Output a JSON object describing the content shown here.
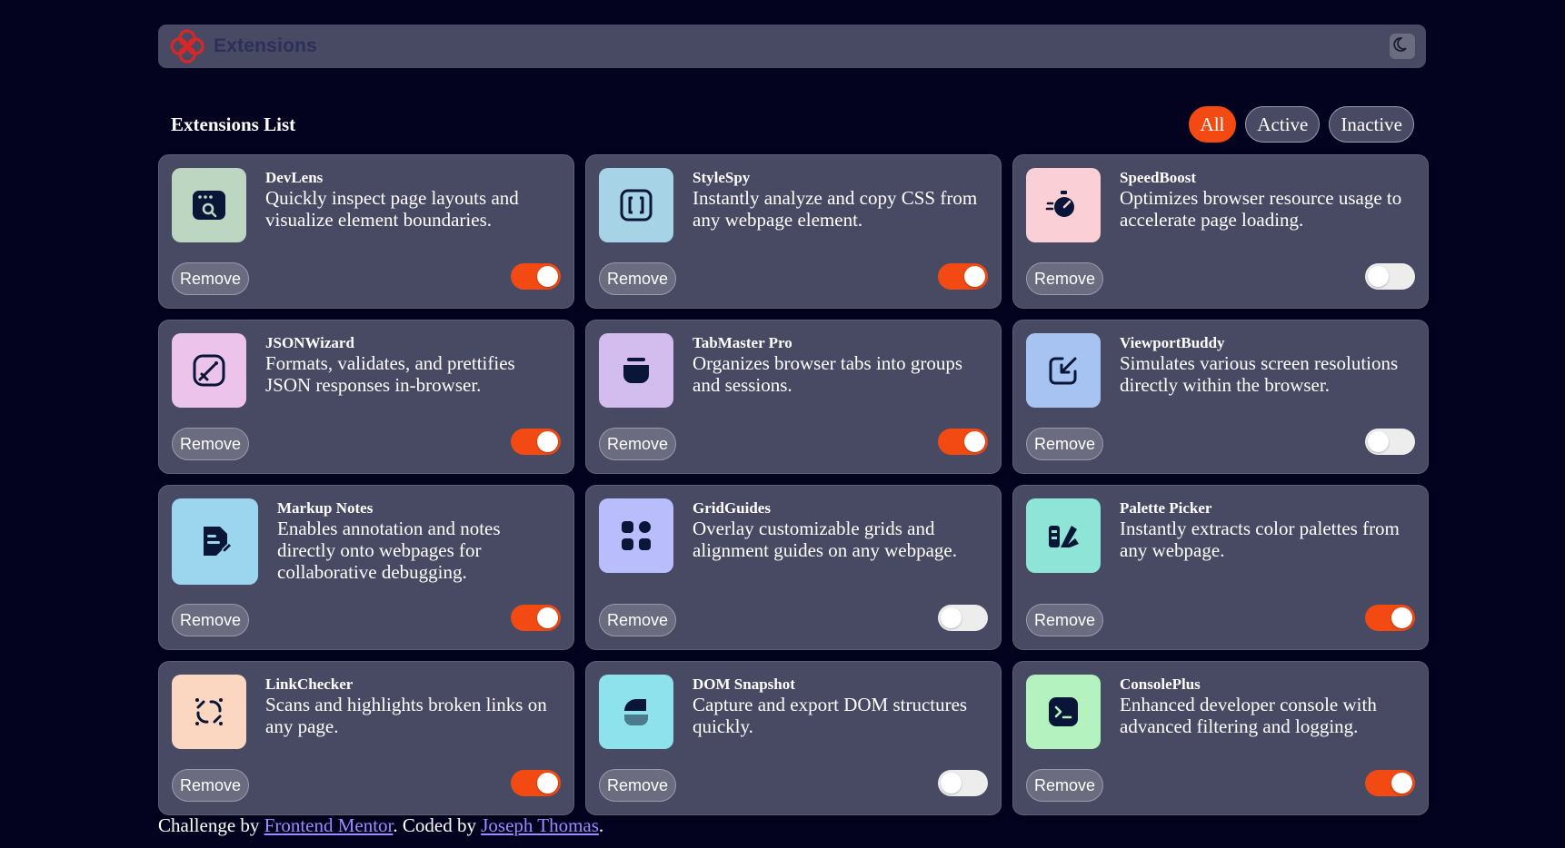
{
  "header": {
    "logo_text": "Extensions",
    "logo_icon": "logo-icon",
    "theme_icon": "moon-icon"
  },
  "list": {
    "title": "Extensions List",
    "filters": [
      "All",
      "Active",
      "Inactive"
    ],
    "selected_filter": "All"
  },
  "extensions": [
    {
      "name": "DevLens",
      "description": "Quickly inspect page layouts and visualize element boundaries.",
      "remove_label": "Remove",
      "active": true,
      "icon_bg": "#bcd6c2",
      "icon": "devlens-icon"
    },
    {
      "name": "StyleSpy",
      "description": "Instantly analyze and copy CSS from any webpage element.",
      "remove_label": "Remove",
      "active": true,
      "icon_bg": "#a6d3e6",
      "icon": "stylespy-icon"
    },
    {
      "name": "SpeedBoost",
      "description": "Optimizes browser resource usage to accelerate page loading.",
      "remove_label": "Remove",
      "active": false,
      "icon_bg": "#fbcfd6",
      "icon": "speedboost-icon"
    },
    {
      "name": "JSONWizard",
      "description": "Formats, validates, and prettifies JSON responses in-browser.",
      "remove_label": "Remove",
      "active": true,
      "icon_bg": "#ecc3ea",
      "icon": "jsonwizard-icon"
    },
    {
      "name": "TabMaster Pro",
      "description": "Organizes browser tabs into groups and sessions.",
      "remove_label": "Remove",
      "active": true,
      "icon_bg": "#d3bdef",
      "icon": "tabmaster-icon"
    },
    {
      "name": "ViewportBuddy",
      "description": "Simulates various screen resolutions directly within the browser.",
      "remove_label": "Remove",
      "active": false,
      "icon_bg": "#a7c3f1",
      "icon": "viewportbuddy-icon"
    },
    {
      "name": "Markup Notes",
      "description": "Enables annotation and notes directly onto webpages for collaborative debugging.",
      "remove_label": "Remove",
      "active": true,
      "icon_bg": "#9bd6ee",
      "icon": "markup-notes-icon"
    },
    {
      "name": "GridGuides",
      "description": "Overlay customizable grids and alignment guides on any webpage.",
      "remove_label": "Remove",
      "active": false,
      "icon_bg": "#b9bdfb",
      "icon": "gridguides-icon"
    },
    {
      "name": "Palette Picker",
      "description": "Instantly extracts color palettes from any webpage.",
      "remove_label": "Remove",
      "active": true,
      "icon_bg": "#8ee4d6",
      "icon": "palette-picker-icon"
    },
    {
      "name": "LinkChecker",
      "description": "Scans and highlights broken links on any page.",
      "remove_label": "Remove",
      "active": true,
      "icon_bg": "#fbd6c0",
      "icon": "linkchecker-icon"
    },
    {
      "name": "DOM Snapshot",
      "description": "Capture and export DOM structures quickly.",
      "remove_label": "Remove",
      "active": false,
      "icon_bg": "#8ee2ec",
      "icon": "dom-snapshot-icon"
    },
    {
      "name": "ConsolePlus",
      "description": "Enhanced developer console with advanced filtering and logging.",
      "remove_label": "Remove",
      "active": true,
      "icon_bg": "#b4f2bf",
      "icon": "consoleplus-icon"
    }
  ],
  "footer": {
    "prefix": "Challenge by ",
    "link1": "Frontend Mentor",
    "middle": ". Coded by ",
    "link2": "Joseph Thomas",
    "suffix": "."
  },
  "colors": {
    "accent": "#f24a12",
    "card": "#484963",
    "background": "#03031f"
  }
}
